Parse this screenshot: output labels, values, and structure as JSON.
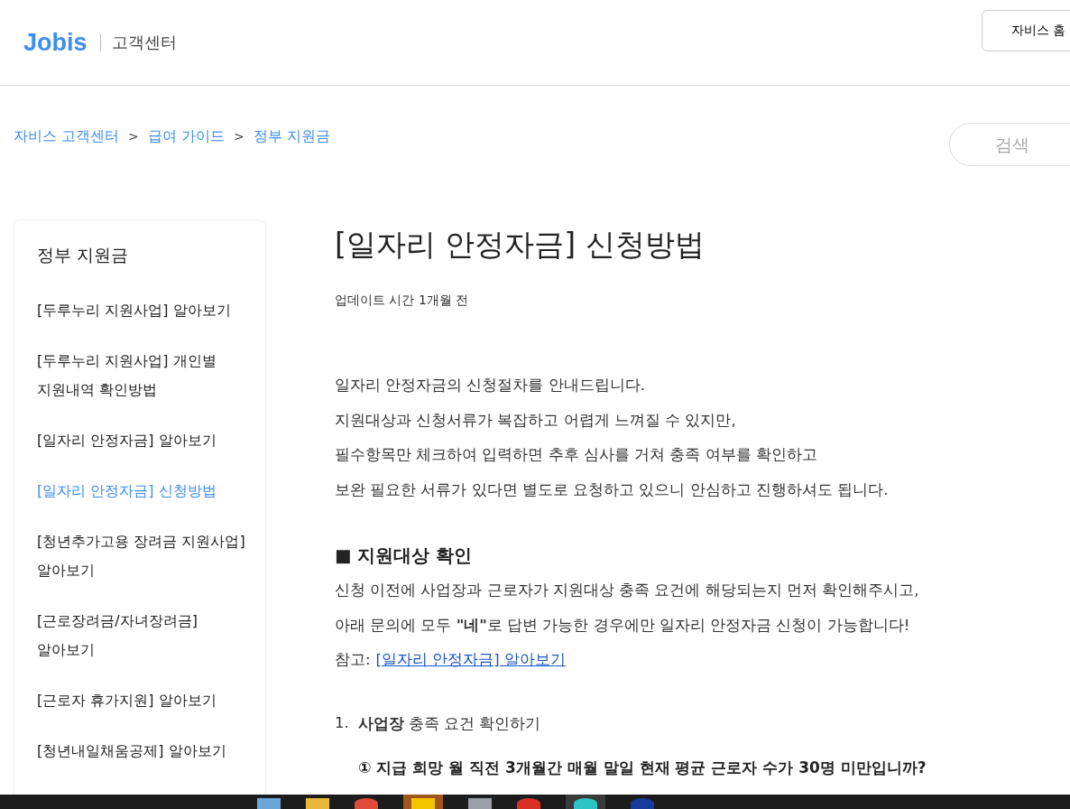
{
  "header": {
    "logo": "Jobis",
    "section": "고객센터",
    "home_button": "자비스 홈"
  },
  "breadcrumb": [
    "자비스 고객센터",
    "급여 가이드",
    "정부 지원금"
  ],
  "breadcrumb_separator": ">",
  "search": {
    "placeholder": "검색"
  },
  "sidebar": {
    "title": "정부 지원금",
    "items": [
      {
        "label": "[두루누리 지원사업] 알아보기",
        "selected": false
      },
      {
        "label": "[두루누리 지원사업] 개인별 지원내역 확인방법",
        "selected": false
      },
      {
        "label": "[일자리 안정자금] 알아보기",
        "selected": false
      },
      {
        "label": "[일자리 안정자금] 신청방법",
        "selected": true
      },
      {
        "label": "[청년추가고용 장려금 지원사업] 알아보기",
        "selected": false
      },
      {
        "label": "[근로장려금/자녀장려금] 알아보기",
        "selected": false
      },
      {
        "label": "[근로자 휴가지원] 알아보기",
        "selected": false
      },
      {
        "label": "[청년내일채움공제] 알아보기",
        "selected": false
      }
    ]
  },
  "article": {
    "title": "[일자리 안정자금] 신청방법",
    "updated": "업데이트 시간 1개월 전",
    "intro": [
      "일자리 안정자금의 신청절차를 안내드립니다.",
      "지원대상과 신청서류가 복잡하고 어렵게 느껴질 수 있지만,",
      "필수항목만 체크하여 입력하면 추후 심사를 거쳐 충족 여부를 확인하고",
      "보완 필요한 서류가 있다면 별도로 요청하고 있으니 안심하고 진행하셔도 됩니다."
    ],
    "section_title": "■ 지원대상 확인",
    "section_lines": [
      "신청 이전에 사업장과 근로자가 지원대상 충족 요건에 해당되는지 먼저 확인해주시고,",
      "아래 문의에 모두 **\"네\"**로 답변 가능한 경우에만 일자리 안정자금 신청이 가능합니다!"
    ],
    "reference_label": "참고:",
    "reference_link": "[일자리 안정자금] 알아보기",
    "step_number": "1.",
    "step_text": "**사업장** 충족 요건 확인하기",
    "question": "① 지급 희망 월 직전 3개월간 매월 말일 현재 평균 근로자 수가 30명 미만입니까?"
  }
}
